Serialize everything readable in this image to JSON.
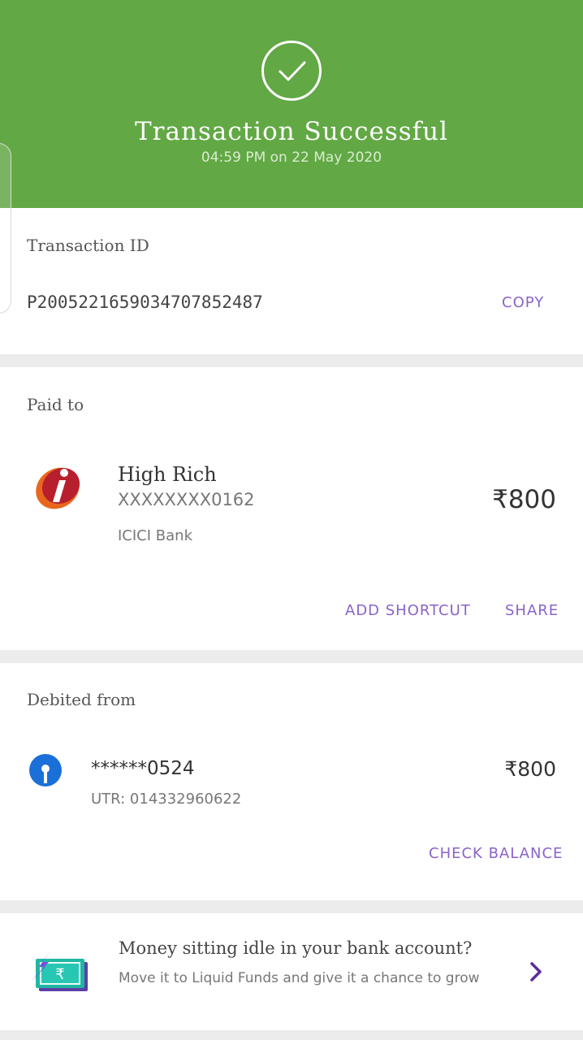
{
  "header": {
    "title": "Transaction Successful",
    "datetime": "04:59 PM on 22 May 2020",
    "bg_color": "#62a845"
  },
  "transaction": {
    "label": "Transaction ID",
    "id": "P2005221659034707852487",
    "copy_label": "COPY"
  },
  "paid_to": {
    "label": "Paid to",
    "name": "High Rich",
    "account": "XXXXXXXX0162",
    "bank": "ICICI Bank",
    "amount": "₹800",
    "bank_icon": "icici-logo-icon",
    "add_shortcut_label": "ADD SHORTCUT",
    "share_label": "SHARE"
  },
  "debited_from": {
    "label": "Debited from",
    "account": "******0524",
    "utr": "UTR: 014332960622",
    "amount": "₹800",
    "bank_icon": "sbi-logo-icon",
    "check_balance_label": "CHECK BALANCE"
  },
  "promo": {
    "title": "Money sitting idle in your bank account?",
    "subtitle": "Move it to Liquid Funds and give it a chance to grow",
    "icon": "money-flash-icon"
  },
  "accent_color": "#8a63c9"
}
